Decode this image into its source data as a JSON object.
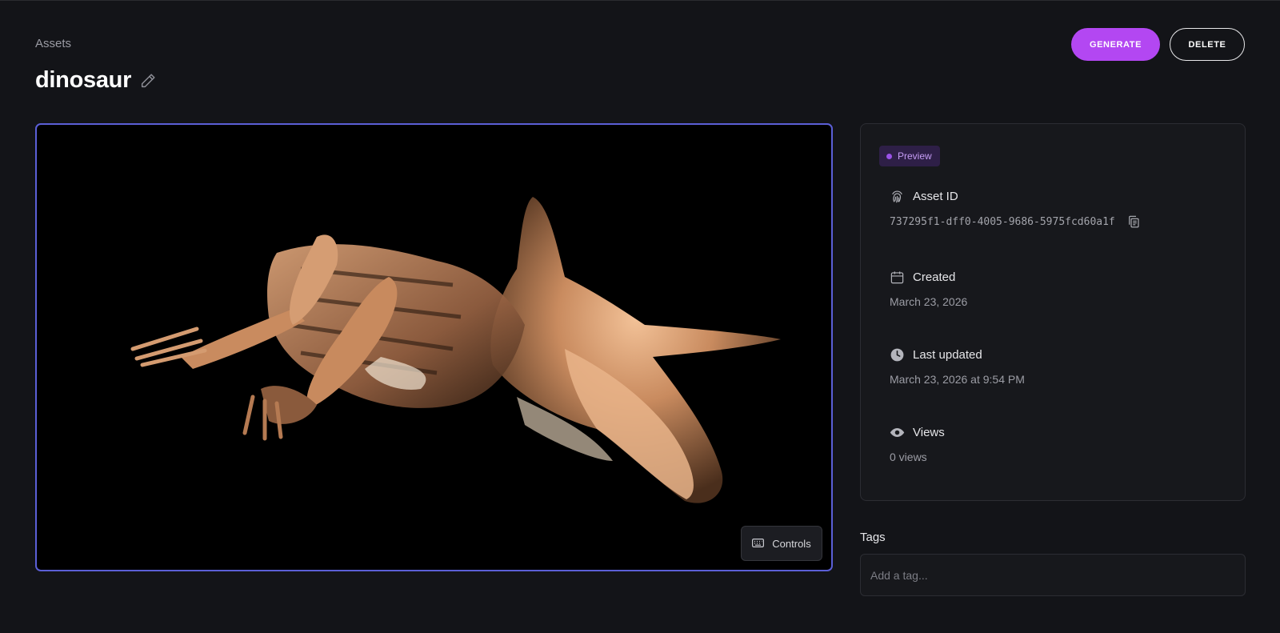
{
  "breadcrumb": "Assets",
  "asset": {
    "title": "dinosaur"
  },
  "actions": {
    "generate_label": "GENERATE",
    "delete_label": "DELETE"
  },
  "viewer": {
    "controls_label": "Controls"
  },
  "details": {
    "badge": "Preview",
    "asset_id_label": "Asset ID",
    "asset_id": "737295f1-dff0-4005-9686-5975fcd60a1f",
    "created_label": "Created",
    "created_value": "March 23, 2026",
    "updated_label": "Last updated",
    "updated_value": "March 23, 2026 at 9:54 PM",
    "views_label": "Views",
    "views_value": "0 views"
  },
  "tags": {
    "label": "Tags",
    "placeholder": "Add a tag..."
  },
  "colors": {
    "accent": "#b347f2",
    "viewer_border": "#5b5fd6",
    "badge_bg": "#2e1f47",
    "badge_text": "#c59cf5"
  },
  "icons": [
    "pencil-icon",
    "keyboard-icon",
    "fingerprint-icon",
    "copy-icon",
    "calendar-icon",
    "clock-icon",
    "eye-icon"
  ]
}
